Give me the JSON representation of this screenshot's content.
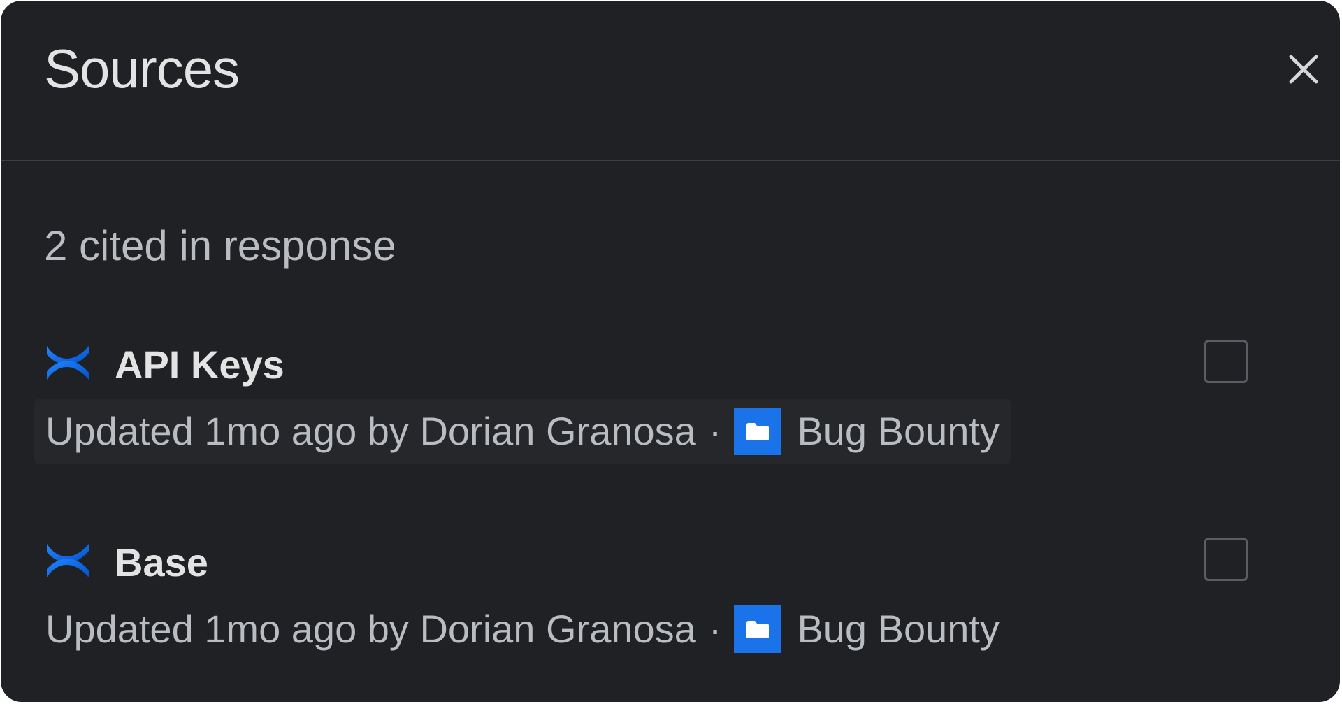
{
  "panel": {
    "title": "Sources",
    "close_icon": "close-icon",
    "section_heading": "2 cited in response"
  },
  "sources": [
    {
      "title": "API Keys",
      "icon": "confluence-icon",
      "updated_text": "Updated 1mo ago by Dorian Granosa",
      "separator": "·",
      "space_icon": "folder-icon",
      "space_name": "Bug Bounty",
      "selected": false
    },
    {
      "title": "Base",
      "icon": "confluence-icon",
      "updated_text": "Updated 1mo ago by Dorian Granosa",
      "separator": "·",
      "space_icon": "folder-icon",
      "space_name": "Bug Bounty",
      "selected": false
    }
  ],
  "colors": {
    "background": "#202124",
    "accent": "#1a73e8",
    "text_primary": "#e3e3e3",
    "text_secondary": "#b9bcc0"
  }
}
